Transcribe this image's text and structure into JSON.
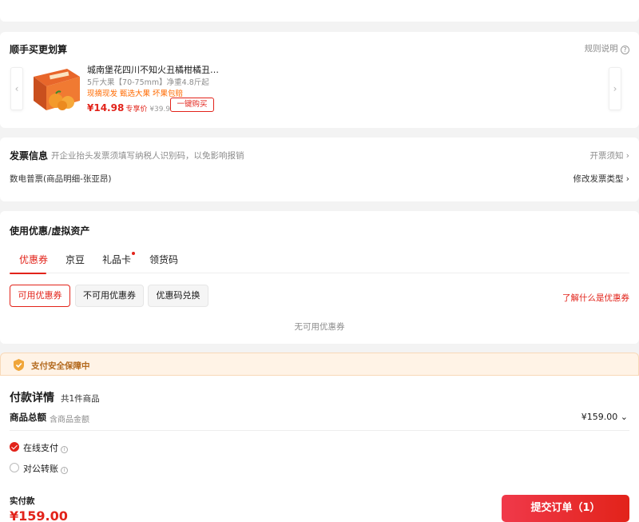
{
  "buy_more": {
    "title": "顺手买更划算",
    "rule_label": "规则说明",
    "product": {
      "name": "城南堡花四川不知火丑橘柑橘丑…",
      "spec": "5斤大果【70-75mm】净重4.8斤起",
      "tags": "现摘现发  甄选大果  坏果包赔",
      "price": "¥14.98",
      "price_label": "专享价",
      "original_price": "¥39.9",
      "buy_button": "一键购买"
    }
  },
  "invoice": {
    "title": "发票信息",
    "hint": "开企业抬头发票须填写纳税人识别码，以免影响报销",
    "notice": "开票须知",
    "type": "数电普票(商品明细-张亚昂)",
    "modify": "修改发票类型"
  },
  "coupon": {
    "title": "使用优惠/虚拟资产",
    "tabs": [
      "优惠券",
      "京豆",
      "礼品卡",
      "领货码"
    ],
    "sub_buttons": [
      "可用优惠券",
      "不可用优惠券",
      "优惠码兑换"
    ],
    "what_link": "了解什么是优惠券",
    "empty": "无可用优惠券"
  },
  "payment": {
    "safe_banner": "支付安全保障中",
    "detail_title": "付款详情",
    "count": "共1件商品",
    "total_label": "商品总额",
    "total_sub": "含商品金额",
    "total_value": "¥159.00",
    "methods": [
      {
        "label": "在线支付",
        "checked": true
      },
      {
        "label": "对公转账",
        "checked": false
      }
    ],
    "actual_label": "实付款",
    "actual_amount": "¥159.00",
    "submit": "提交订单（1）"
  },
  "colors": {
    "accent": "#e2231a",
    "orange": "#ff6a00",
    "safe_bg": "#fff3e6"
  }
}
